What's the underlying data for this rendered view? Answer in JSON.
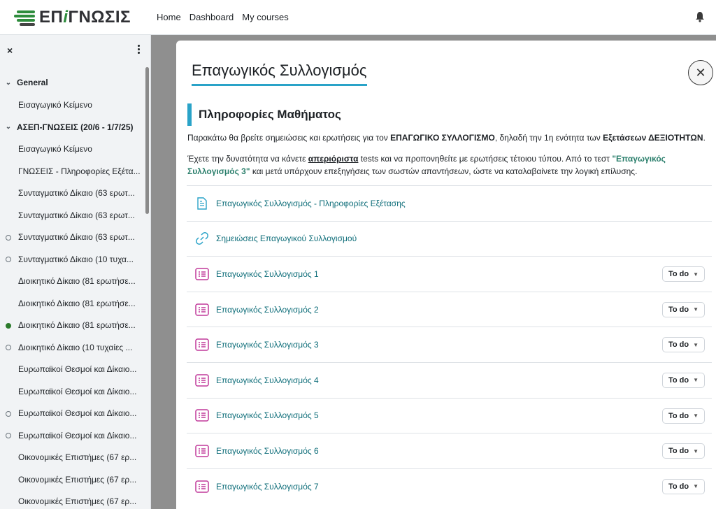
{
  "header": {
    "logo_prefix": "ΕΠ",
    "logo_i": "i",
    "logo_suffix": "ΓΝΩΣΙΣ",
    "nav": [
      "Home",
      "Dashboard",
      "My courses"
    ],
    "icons": {
      "bell": "bell-icon"
    }
  },
  "sidebar": {
    "close_label": "×",
    "sections": [
      {
        "title": "General",
        "items": [
          {
            "label": "Εισαγωγικό Κείμενο",
            "status": "none"
          }
        ]
      },
      {
        "title": "ΑΣΕΠ-ΓΝΩΣΕΙΣ (20/6 - 1/7/25)",
        "items": [
          {
            "label": "Εισαγωγικό Κείμενο",
            "status": "none"
          },
          {
            "label": "ΓΝΩΣΕΙΣ - Πληροφορίες Εξέτα...",
            "status": "none"
          },
          {
            "label": "Συνταγματικό Δίκαιο (63 ερωτ...",
            "status": "none"
          },
          {
            "label": "Συνταγματικό Δίκαιο (63 ερωτ...",
            "status": "none"
          },
          {
            "label": "Συνταγματικό Δίκαιο (63 ερωτ...",
            "status": "empty"
          },
          {
            "label": "Συνταγματικό Δίκαιο (10 τυχα...",
            "status": "empty"
          },
          {
            "label": "Διοικητικό Δίκαιο (81 ερωτήσε...",
            "status": "none"
          },
          {
            "label": "Διοικητικό Δίκαιο (81 ερωτήσε...",
            "status": "none"
          },
          {
            "label": "Διοικητικό Δίκαιο (81 ερωτήσε...",
            "status": "full"
          },
          {
            "label": "Διοικητικό Δίκαιο (10 τυχαίες ...",
            "status": "empty"
          },
          {
            "label": "Ευρωπαϊκοί Θεσμοί και Δίκαιο...",
            "status": "none"
          },
          {
            "label": "Ευρωπαϊκοί Θεσμοί και Δίκαιο...",
            "status": "none"
          },
          {
            "label": "Ευρωπαϊκοί Θεσμοί και Δίκαιο...",
            "status": "empty"
          },
          {
            "label": "Ευρωπαϊκοί Θεσμοί και Δίκαιο...",
            "status": "empty"
          },
          {
            "label": "Οικονομικές Επιστήμες (67 ερ...",
            "status": "none"
          },
          {
            "label": "Οικονομικές Επιστήμες (67 ερ...",
            "status": "none"
          },
          {
            "label": "Οικονομικές Επιστήμες (67 ερ...",
            "status": "none"
          }
        ]
      }
    ]
  },
  "modal": {
    "title": "Επαγωγικός Συλλογισμός",
    "close_label": "✕",
    "info_heading": "Πληροφορίες Μαθήματος",
    "p1_a": "Παρακάτω θα βρείτε σημειώσεις και ερωτήσεις για τον ",
    "p1_b": "ΕΠΑΓΩΓΙΚΟ ΣΥΛΛΟΓΙΣΜΟ",
    "p1_c": ", δηλαδή την 1η ενότητα των ",
    "p1_d": "Εξετάσεων ΔΕΞΙΟΤΗΤΩΝ",
    "p1_e": ".",
    "p2_a": "Έχετε την δυνατότητα να κάνετε ",
    "p2_b": "απεριόριστα",
    "p2_c": " tests και να προπονηθείτε με ερωτήσεις τέτοιου τύπου. Από το τεστ ",
    "p2_d": "\"Επαγωγικός Συλλογισμός 3\"",
    "p2_e": " και μετά υπάρχουν επεξηγήσεις των σωστών απαντήσεων, ώστε να καταλαβαίνετε την λογική επίλυσης.",
    "activities": [
      {
        "label": "Επαγωγικός Συλλογισμός - Πληροφορίες Εξέτασης",
        "icon": "page-icon",
        "todo": ""
      },
      {
        "label": "Σημειώσεις Επαγωγικού Συλλογισμού",
        "icon": "link-icon",
        "todo": ""
      },
      {
        "label": "Επαγωγικός Συλλογισμός 1",
        "icon": "quiz-icon",
        "todo": "To do"
      },
      {
        "label": "Επαγωγικός Συλλογισμός 2",
        "icon": "quiz-icon",
        "todo": "To do"
      },
      {
        "label": "Επαγωγικός Συλλογισμός 3",
        "icon": "quiz-icon",
        "todo": "To do"
      },
      {
        "label": "Επαγωγικός Συλλογισμός 4",
        "icon": "quiz-icon",
        "todo": "To do"
      },
      {
        "label": "Επαγωγικός Συλλογισμός 5",
        "icon": "quiz-icon",
        "todo": "To do"
      },
      {
        "label": "Επαγωγικός Συλλογισμός 6",
        "icon": "quiz-icon",
        "todo": "To do"
      },
      {
        "label": "Επαγωγικός Συλλογισμός 7",
        "icon": "quiz-icon",
        "todo": "To do"
      }
    ]
  },
  "colors": {
    "accent": "#2aa3c8",
    "link": "#0f6e7a",
    "quiz": "#c0399a",
    "done_dot": "#2b7a2b"
  }
}
